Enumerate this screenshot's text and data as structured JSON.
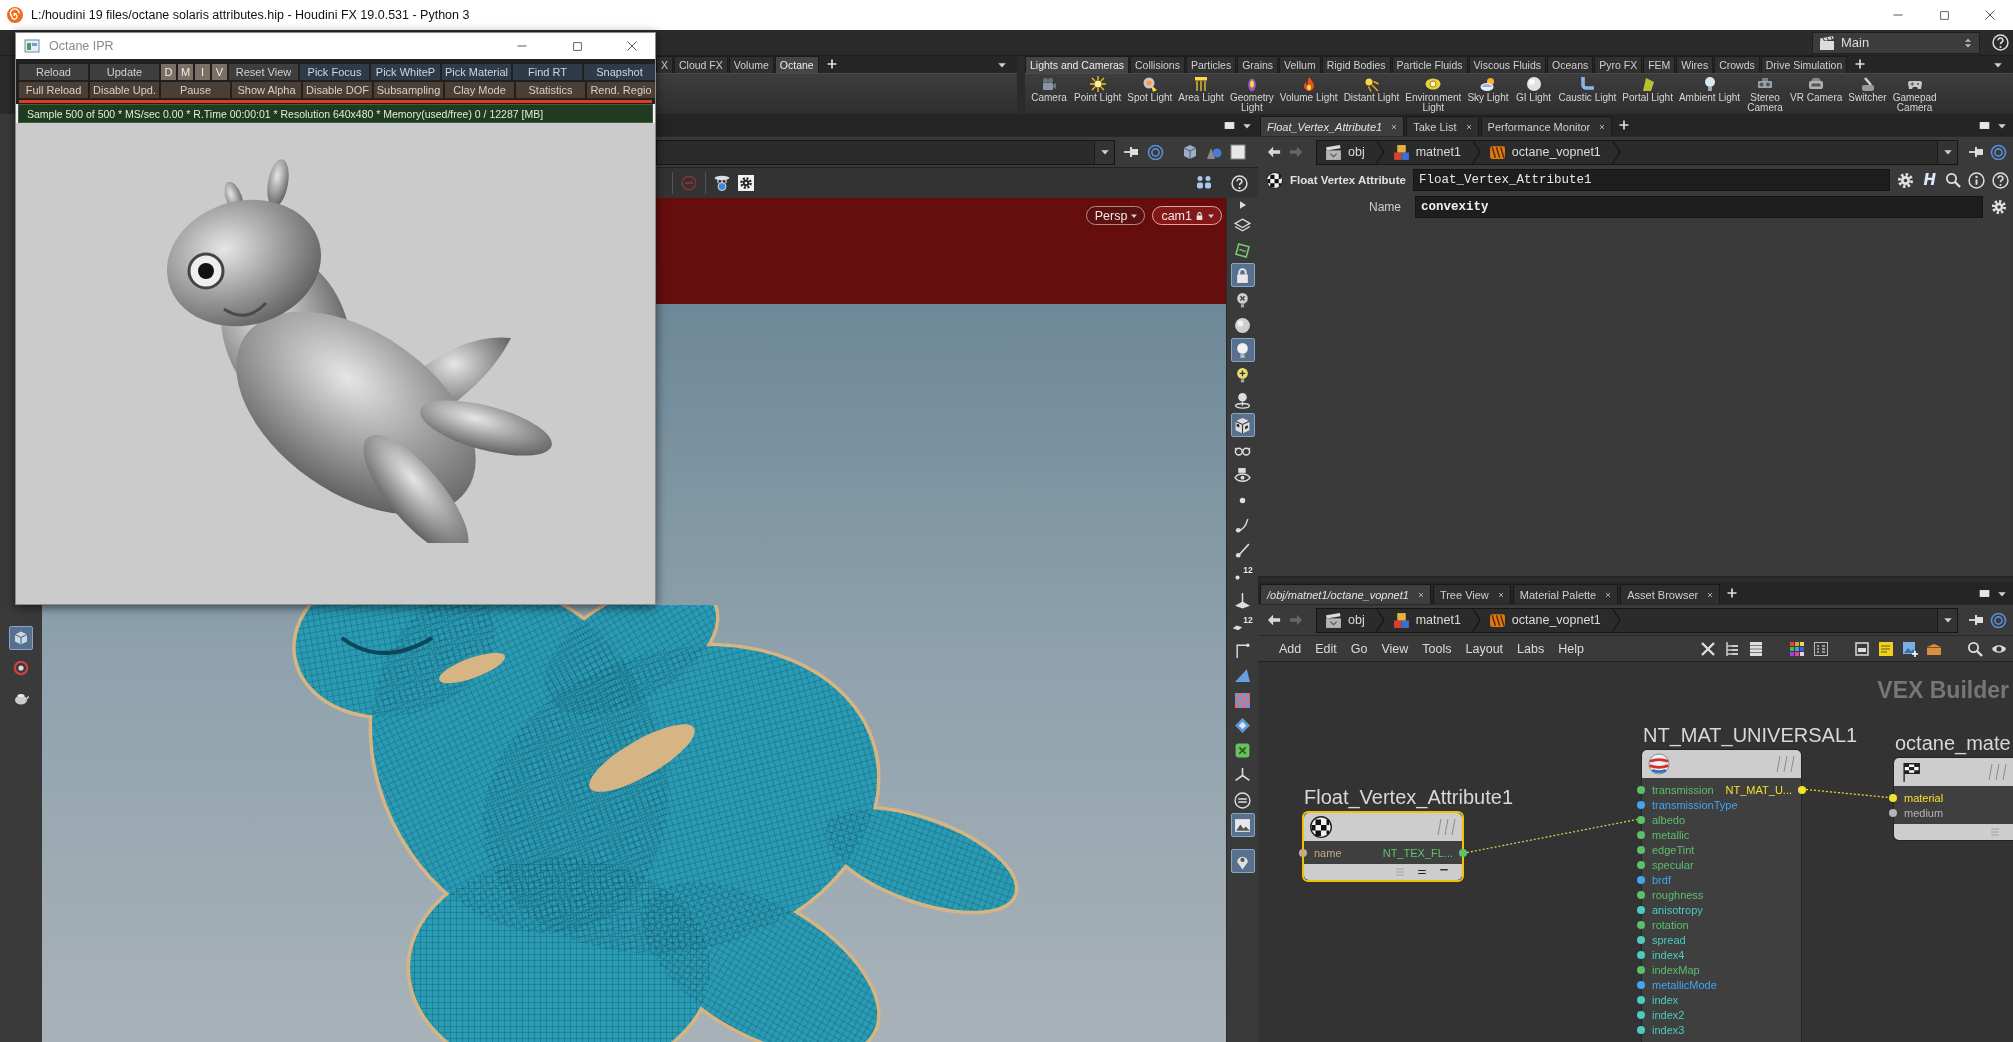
{
  "window": {
    "title": "L:/houdini 19 files/octane solaris attributes.hip - Houdini FX 19.0.531 - Python 3"
  },
  "desktop": {
    "label": "Main"
  },
  "shelf_left": {
    "tabs": [
      {
        "label": "X",
        "selected": false
      },
      {
        "label": "Cloud FX",
        "selected": false
      },
      {
        "label": "Volume",
        "selected": false
      },
      {
        "label": "Octane",
        "selected": true
      }
    ]
  },
  "shelf_right": {
    "tabs": [
      {
        "label": "Lights and Cameras",
        "selected": true
      },
      {
        "label": "Collisions",
        "selected": false
      },
      {
        "label": "Particles",
        "selected": false
      },
      {
        "label": "Grains",
        "selected": false
      },
      {
        "label": "Vellum",
        "selected": false
      },
      {
        "label": "Rigid Bodies",
        "selected": false
      },
      {
        "label": "Particle Fluids",
        "selected": false
      },
      {
        "label": "Viscous Fluids",
        "selected": false
      },
      {
        "label": "Oceans",
        "selected": false
      },
      {
        "label": "Pyro FX",
        "selected": false
      },
      {
        "label": "FEM",
        "selected": false
      },
      {
        "label": "Wires",
        "selected": false
      },
      {
        "label": "Crowds",
        "selected": false
      },
      {
        "label": "Drive Simulation",
        "selected": false
      }
    ],
    "tools": [
      {
        "label": "Camera"
      },
      {
        "label": "Point Light"
      },
      {
        "label": "Spot Light"
      },
      {
        "label": "Area Light"
      },
      {
        "label": "Geometry\nLight"
      },
      {
        "label": "Volume Light"
      },
      {
        "label": "Distant Light"
      },
      {
        "label": "Environment\nLight"
      },
      {
        "label": "Sky Light"
      },
      {
        "label": "GI Light"
      },
      {
        "label": "Caustic Light"
      },
      {
        "label": "Portal Light"
      },
      {
        "label": "Ambient Light"
      },
      {
        "label": "Stereo\nCamera"
      },
      {
        "label": "VR Camera"
      },
      {
        "label": "Switcher"
      },
      {
        "label": "Gamepad\nCamera"
      }
    ]
  },
  "scene_viewer": {
    "view_menu": "Persp",
    "camera_menu": "cam1",
    "display_tools": [
      {
        "on": false
      },
      {
        "on": false
      },
      {
        "on": true
      },
      {
        "on": false
      },
      {
        "on": false
      },
      {
        "on": true
      },
      {
        "on": false
      },
      {
        "on": false
      },
      {
        "on": true
      },
      {
        "on": false
      },
      {
        "on": false
      },
      {
        "on": false
      },
      {
        "on": false
      },
      {
        "on": false
      },
      {
        "on": false,
        "label": "12"
      },
      {
        "on": false
      },
      {
        "on": false,
        "label": "12"
      },
      {
        "on": false
      },
      {
        "on": false
      },
      {
        "on": false
      },
      {
        "on": false
      },
      {
        "on": false
      },
      {
        "on": false
      },
      {
        "on": false
      },
      {
        "on": true
      },
      {
        "on": true
      }
    ],
    "side_tools": [
      {
        "on": true
      },
      {
        "on": false
      },
      {
        "on": false
      }
    ]
  },
  "octane_ipr": {
    "title": "Octane IPR",
    "button_rows": [
      [
        {
          "label": "Reload",
          "kind": "command"
        },
        {
          "label": "Update",
          "kind": "command"
        },
        {
          "label": "D",
          "kind": "flag"
        },
        {
          "label": "M",
          "kind": "flag"
        },
        {
          "label": "I",
          "kind": "flag"
        },
        {
          "label": "V",
          "kind": "flag"
        },
        {
          "label": "Reset View",
          "kind": "command"
        },
        {
          "label": "Pick Focus",
          "kind": "tool"
        },
        {
          "label": "Pick WhiteP",
          "kind": "tool"
        },
        {
          "label": "Pick Material",
          "kind": "tool"
        },
        {
          "label": "Find RT",
          "kind": "tool"
        },
        {
          "label": "Snapshot",
          "kind": "tool"
        }
      ],
      [
        {
          "label": "Full Reload",
          "kind": "option"
        },
        {
          "label": "Disable Upd.",
          "kind": "option"
        },
        {
          "label": "Pause",
          "kind": "option"
        },
        {
          "label": "Show Alpha",
          "kind": "option"
        },
        {
          "label": "Disable DOF",
          "kind": "option"
        },
        {
          "label": "Subsampling",
          "kind": "option"
        },
        {
          "label": "Clay Mode",
          "kind": "option"
        },
        {
          "label": "Statistics",
          "kind": "option"
        },
        {
          "label": "Rend. Regio",
          "kind": "option"
        }
      ]
    ],
    "progress": {
      "level": 1
    },
    "status": "Sample 500 of 500 * MS/sec 0.00 * R.Time 00:00:01 * Resolution 640x480 * Memory(used/free) 0 / 12287 [MB]"
  },
  "parameters": {
    "tabs": [
      {
        "label": "Float_Vertex_Attribute1",
        "selected": true
      },
      {
        "label": "Take List",
        "selected": false
      },
      {
        "label": "Performance Monitor",
        "selected": false
      }
    ],
    "path": [
      "obj",
      "matnet1",
      "octane_vopnet1"
    ],
    "node_type": "Float Vertex Attribute",
    "node_name": "Float_Vertex_Attribute1",
    "h_menu": "H",
    "fields": [
      {
        "label": "Name",
        "value": "convexity"
      }
    ]
  },
  "network": {
    "tabs": [
      {
        "label": "/obj/matnet1/octane_vopnet1",
        "selected": true
      },
      {
        "label": "Tree View",
        "selected": false
      },
      {
        "label": "Material Palette",
        "selected": false
      },
      {
        "label": "Asset Browser",
        "selected": false
      }
    ],
    "path": [
      "obj",
      "matnet1",
      "octane_vopnet1"
    ],
    "menu": [
      "Add",
      "Edit",
      "Go",
      "View",
      "Tools",
      "Layout",
      "Labs",
      "Help"
    ],
    "context_label": "VEX Builder",
    "nodes": [
      {
        "name": "Float_Vertex_Attribute1",
        "selected": true,
        "inputs": [
          {
            "label": "name",
            "color": "#c8a888"
          }
        ],
        "outputs": [
          {
            "label": "NT_TEX_FL...",
            "color": "#5cc46c"
          }
        ]
      },
      {
        "name": "NT_MAT_UNIVERSAL1",
        "selected": false,
        "inputs": [
          {
            "label": "transmission",
            "color": "#5cbf6a"
          },
          {
            "label": "transmissionType",
            "color": "#44a4f0"
          },
          {
            "label": "albedo",
            "color": "#5cbf6a"
          },
          {
            "label": "metallic",
            "color": "#5cbf6a"
          },
          {
            "label": "edgeTint",
            "color": "#5cbf6a"
          },
          {
            "label": "specular",
            "color": "#5cbf6a"
          },
          {
            "label": "brdf",
            "color": "#44a4f0"
          },
          {
            "label": "roughness",
            "color": "#5cbf6a"
          },
          {
            "label": "anisotropy",
            "color": "#4ccbbf"
          },
          {
            "label": "rotation",
            "color": "#5cbf6a"
          },
          {
            "label": "spread",
            "color": "#4ccbbf"
          },
          {
            "label": "index4",
            "color": "#4ccbbf"
          },
          {
            "label": "indexMap",
            "color": "#5cbf6a"
          },
          {
            "label": "metallicMode",
            "color": "#44a4f0"
          },
          {
            "label": "index",
            "color": "#4ccbbf"
          },
          {
            "label": "index2",
            "color": "#4ccbbf"
          },
          {
            "label": "index3",
            "color": "#4ccbbf"
          }
        ],
        "outputs": [
          {
            "label": "NT_MAT_U...",
            "color": "#f5e02a"
          }
        ]
      },
      {
        "name": "octane_mate",
        "selected": false,
        "inputs": [
          {
            "label": "material",
            "color": "#f5e02a"
          },
          {
            "label": "medium",
            "color": "#b4b4b4"
          }
        ]
      }
    ]
  }
}
